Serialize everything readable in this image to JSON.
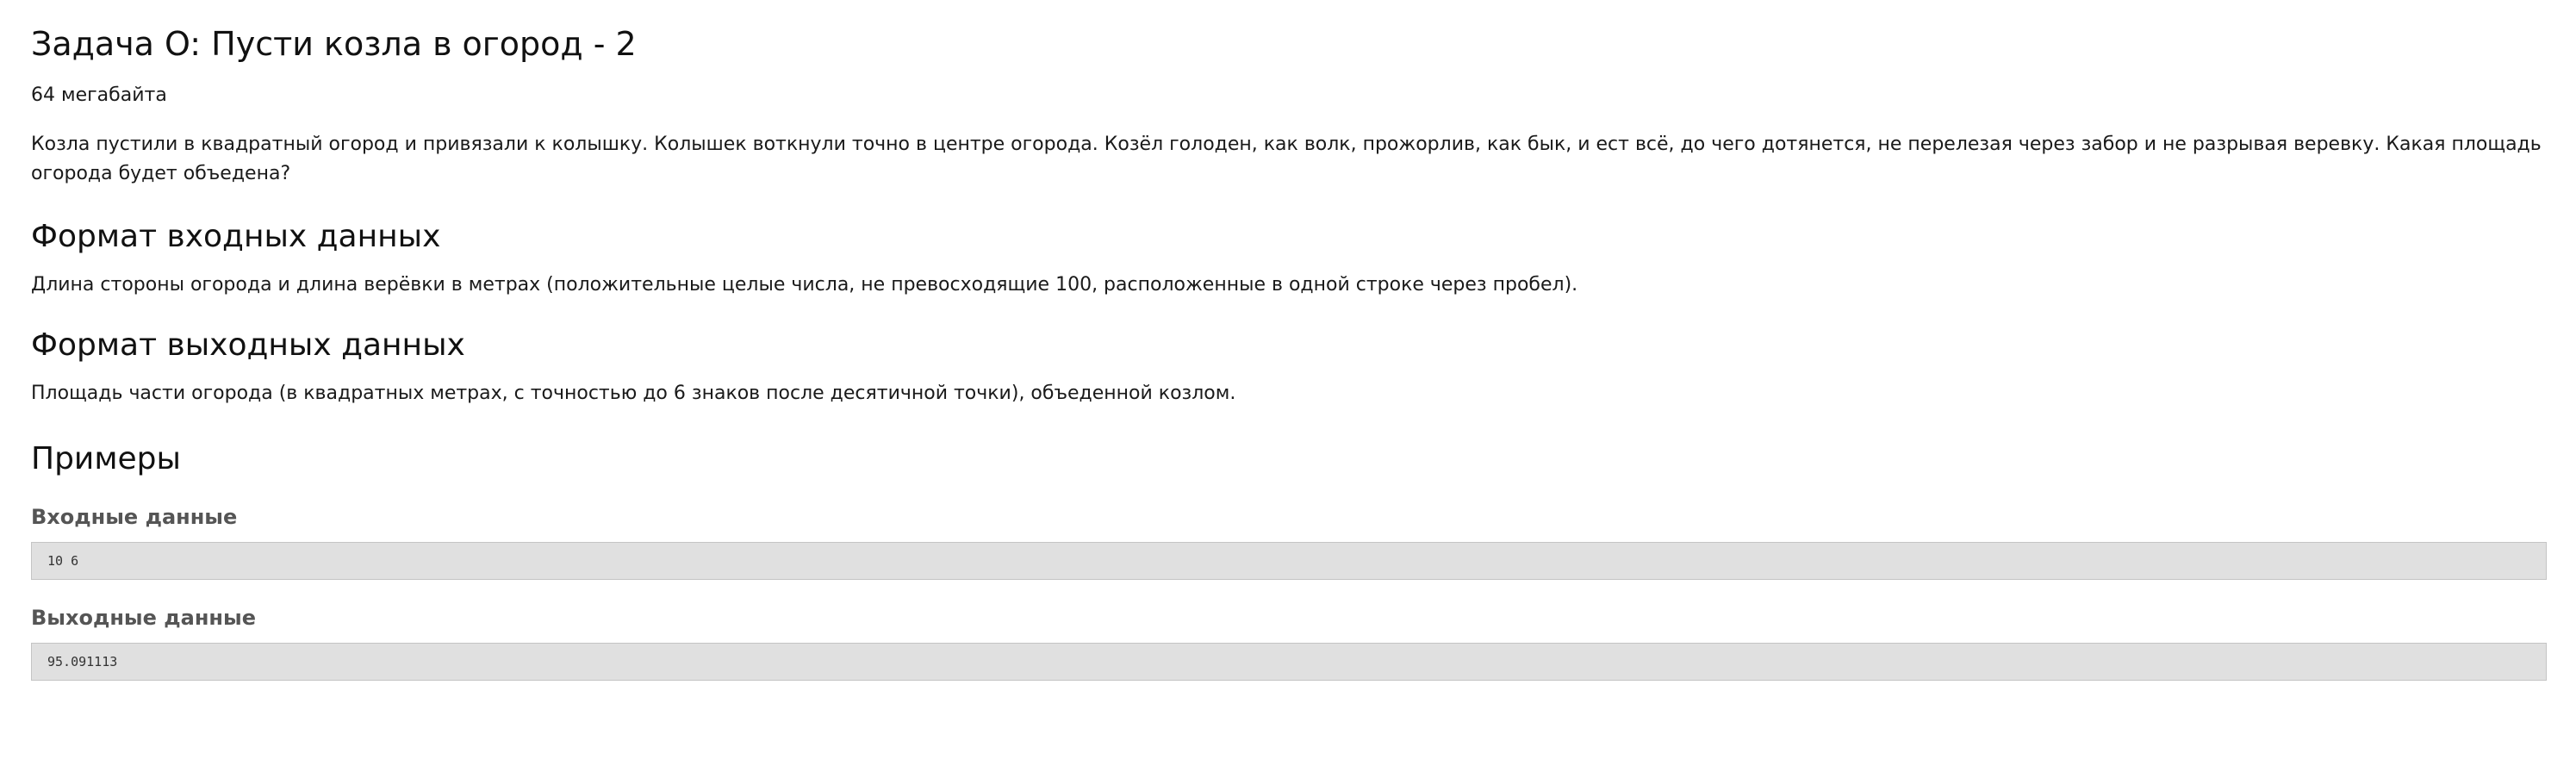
{
  "problem": {
    "title": "Задача O: Пусти козла в огород - 2",
    "memory_limit": "64 мегабайта",
    "legend": "Козла пустили в квадратный огород и привязали к колышку. Колышек воткнули точно в центре огорода. Козёл голоден, как волк, прожорлив, как бык, и ест всё, до чего дотянется, не перелезая через забор и не разрывая веревку. Какая площадь огорода будет объедена?"
  },
  "input_section": {
    "heading": "Формат входных данных",
    "text": "Длина стороны огорода и длина верёвки в метрах (положительные целые числа, не превосходящие 100, расположенные в одной строке через пробел)."
  },
  "output_section": {
    "heading": "Формат выходных данных",
    "text": "Площадь части огорода (в квадратных метрах, с точностью до 6 знаков после десятичной точки), объеденной козлом."
  },
  "examples": {
    "heading": "Примеры",
    "input_label": "Входные данные",
    "input_value": "10 6",
    "output_label": "Выходные данные",
    "output_value": "95.091113"
  }
}
